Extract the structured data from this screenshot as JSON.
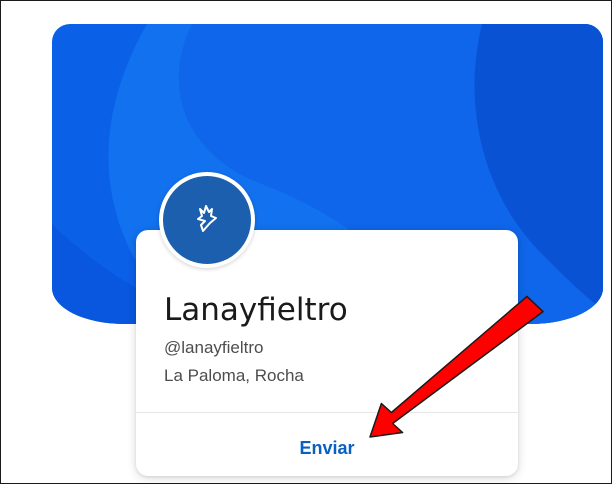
{
  "profile": {
    "name": "Lanayfieltro",
    "handle": "@lanayfieltro",
    "location": "La Paloma, Rocha"
  },
  "actions": {
    "send_label": "Enviar"
  },
  "icons": {
    "avatar": "hand-icon",
    "annotation": "red-arrow-icon"
  },
  "colors": {
    "banner_primary": "#0b60e8",
    "banner_light": "#1578f0",
    "banner_dark": "#0a4fd0",
    "avatar_bg": "#1b5fae",
    "link": "#0a5fc2",
    "arrow": "#ff0000"
  }
}
